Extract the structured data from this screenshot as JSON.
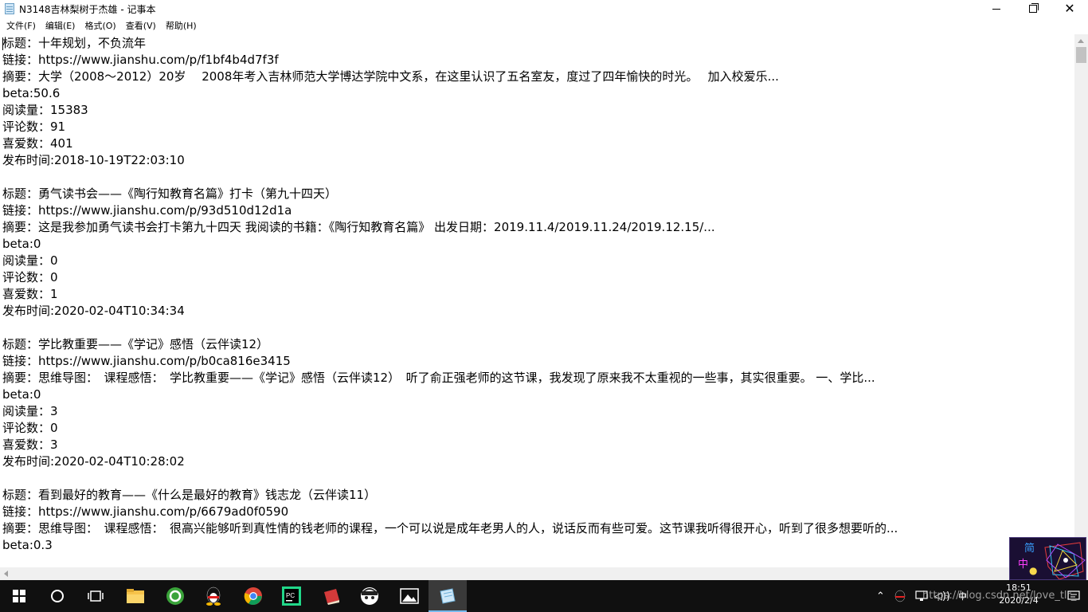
{
  "window": {
    "title": "N3148吉林梨树于杰雄 - 记事本",
    "close_glyph": "✕"
  },
  "menu": [
    "文件(F)",
    "编辑(E)",
    "格式(O)",
    "查看(V)",
    "帮助(H)"
  ],
  "editor": {
    "lines": [
      "标题：十年规划，不负流年",
      "链接：https://www.jianshu.com/p/f1bf4b4d7f3f",
      "摘要：大学（2008～2012）20岁　 2008年考入吉林师范大学博达学院中文系，在这里认识了五名室友，度过了四年愉快的时光。　 加入校爱乐...",
      "beta:50.6",
      "阅读量：15383",
      "评论数：91",
      "喜爱数：401",
      "发布时间:2018-10-19T22:03:10",
      "",
      "标题：勇气读书会——《陶行知教育名篇》打卡（第九十四天）",
      "链接：https://www.jianshu.com/p/93d510d12d1a",
      "摘要：这是我参加勇气读书会打卡第九十四天 我阅读的书籍：《陶行知教育名篇》 出发日期：2019.11.4/2019.11.24/2019.12.15/...",
      "beta:0",
      "阅读量：0",
      "评论数：0",
      "喜爱数：1",
      "发布时间:2020-02-04T10:34:34",
      "",
      "标题：学比教重要——《学记》感悟（云伴读12）",
      "链接：https://www.jianshu.com/p/b0ca816e3415",
      "摘要：思维导图：　课程感悟：　学比教重要——《学记》感悟（云伴读12）　听了俞正强老师的这节课，我发现了原来我不太重视的一些事，其实很重要。 一、学比...",
      "beta:0",
      "阅读量：3",
      "评论数：0",
      "喜爱数：3",
      "发布时间:2020-02-04T10:28:02",
      "",
      "标题：看到最好的教育——《什么是最好的教育》钱志龙（云伴读11）",
      "链接：https://www.jianshu.com/p/6679ad0f0590",
      "摘要：思维导图：　课程感悟：　很高兴能够听到真性情的钱老师的课程，一个可以说是成年老男人的人，说话反而有些可爱。这节课我听得很开心，听到了很多想要听的...",
      "beta:0.3"
    ]
  },
  "ime_widget": {
    "char_top": "简",
    "char_bottom": "中"
  },
  "taskbar": {
    "icons": [
      "windows-start",
      "search-circle",
      "task-view",
      "file-explorer",
      "360-browser",
      "qq-penguin",
      "chrome",
      "pycharm",
      "red-app",
      "avatar-app",
      "photos",
      "notepad"
    ],
    "tray_ime": "中",
    "clock_time": "18:51",
    "clock_date": "2020/2/4",
    "watermark": "https://blog.csdn.net/love_tlr_"
  },
  "colors": {
    "taskbar_bg": "#101010",
    "active_accent": "#76b9ed",
    "scrollbar_bg": "#f0f0f0"
  }
}
